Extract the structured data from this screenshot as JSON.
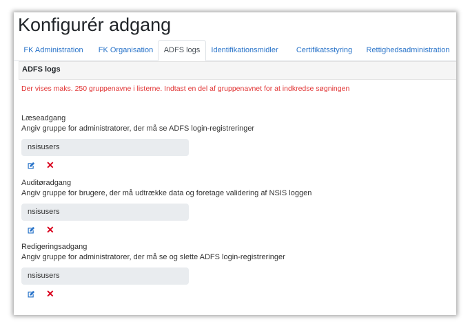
{
  "page": {
    "title": "Konfigurér adgang"
  },
  "tabs": [
    {
      "label": "FK Administration",
      "active": false
    },
    {
      "label": "FK Organisation",
      "active": false
    },
    {
      "label": "ADFS logs",
      "active": true
    },
    {
      "label": "Identifikationsmidler",
      "active": false
    },
    {
      "label": "Certifikatsstyring",
      "active": false
    },
    {
      "label": "Rettighedsadministration",
      "active": false
    }
  ],
  "section": {
    "header": "ADFS logs",
    "warning": "Der vises maks. 250 gruppenavne i listerne. Indtast en del af gruppenavnet for at indkredse søgningen"
  },
  "groups": [
    {
      "label": "Læseadgang",
      "description": "Angiv gruppe for administratorer, der må se ADFS login-registreringer",
      "value": "nsisusers"
    },
    {
      "label": "Auditøradgang",
      "description": "Angiv gruppe for brugere, der må udtrække data og foretage validering af NSIS loggen",
      "value": "nsisusers"
    },
    {
      "label": "Redigeringsadgang",
      "description": "Angiv gruppe for administratorer, der må se og slette ADFS login-registreringer",
      "value": "nsisusers"
    }
  ],
  "icons": {
    "edit": "edit-icon",
    "delete": "close-icon"
  },
  "colors": {
    "link": "#2a74c9",
    "warning": "#e03131",
    "delete": "#d9001b",
    "field_bg": "#e9ecef"
  }
}
